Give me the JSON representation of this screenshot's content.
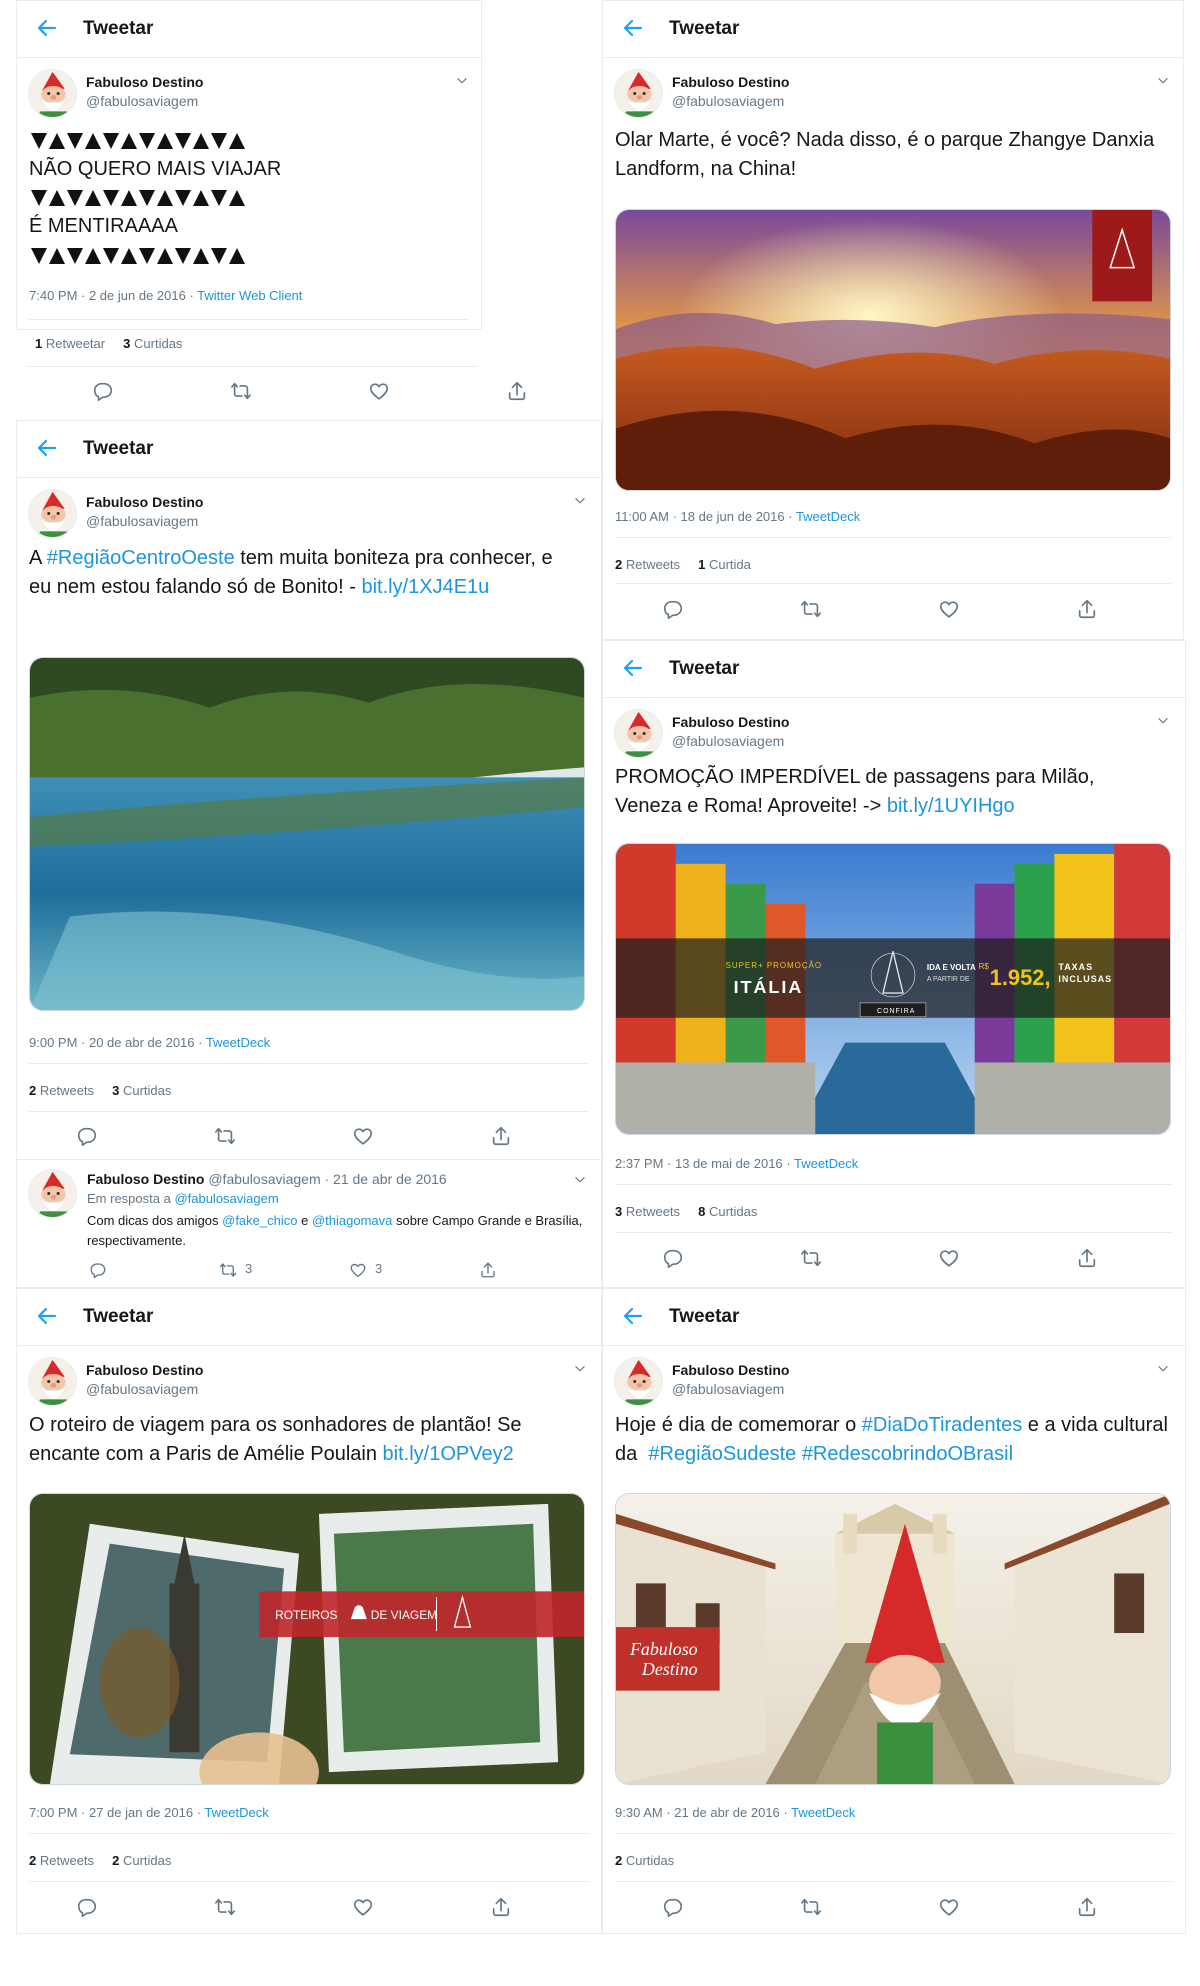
{
  "header_title": "Tweetar",
  "user": {
    "name": "Fabuloso Destino",
    "handle": "@fabulosaviagem"
  },
  "accent": "#1b95e0",
  "tweets": {
    "t1": {
      "line2": "NÃO QUERO MAIS VIAJAR",
      "line4": "É MENTIRAAAA",
      "time": "7:40 PM · 2 de jun de 2016 · ",
      "source": "Twitter Web Client",
      "stat1_num": "1",
      "stat1_label": " Retweetar",
      "stat2_num": "3",
      "stat2_label": " Curtidas"
    },
    "t2": {
      "text": "Olar Marte, é você? Nada disso, é o parque Zhangye Danxia Landform, na China!",
      "time": "11:00 AM · 18 de jun de 2016 · ",
      "source": "TweetDeck",
      "stat1_num": "2",
      "stat1_label": " Retweets",
      "stat2_num": "1",
      "stat2_label": " Curtida"
    },
    "t3": {
      "text_a": "A ",
      "hashtag": "#RegiãoCentroOeste",
      "text_b": " tem muita boniteza pra conhecer, e eu nem estou falando só de Bonito! - ",
      "link": "bit.ly/1XJ4E1u",
      "time": "9:00 PM · 20 de abr de 2016 · ",
      "source": "TweetDeck",
      "stat1_num": "2",
      "stat1_label": " Retweets",
      "stat2_num": "3",
      "stat2_label": " Curtidas"
    },
    "t3_reply": {
      "meta": " @fabulosaviagem · 21 de abr de 2016",
      "in_reply": "Em resposta a ",
      "in_reply_handle": "@fabulosaviagem",
      "text_a": "Com dicas dos amigos ",
      "mention1": "@fake_chico",
      "text_b": " e ",
      "mention2": "@thiagomava",
      "text_c": " sobre Campo Grande e Brasília, respectivamente.",
      "retweets": "3",
      "likes": "3"
    },
    "t4": {
      "text_a": "PROMOÇÃO IMPERDÍVEL de passagens para Milão, Veneza e Roma! Aproveite! -> ",
      "link": "bit.ly/1UYIHgo",
      "banner_small": "SUPER+ PROMOÇÃO",
      "banner_big": "ITÁLIA",
      "banner_cta": "CONFIRA",
      "banner_idavolta": "IDA E VOLTA",
      "banner_apartir": "A PARTIR DE",
      "banner_currency": "R$",
      "banner_price": "1.952,",
      "banner_taxas": "TAXAS",
      "banner_inclusas": "INCLUSAS",
      "time": "2:37 PM · 13 de mai de 2016 · ",
      "source": "TweetDeck",
      "stat1_num": "3",
      "stat1_label": " Retweets",
      "stat2_num": "8",
      "stat2_label": " Curtidas"
    },
    "t5": {
      "text_a": "O roteiro de viagem para os sonhadores de plantão! Se encante com a Paris de Amélie Poulain ",
      "link": "bit.ly/1OPVey2",
      "banner_a": "ROTEIROS",
      "banner_b": "DE VIAGEM",
      "time": "7:00 PM · 27 de jan de 2016 · ",
      "source": "TweetDeck",
      "stat1_num": "2",
      "stat1_label": " Retweets",
      "stat2_num": "2",
      "stat2_label": " Curtidas"
    },
    "t6": {
      "text_a": "Hoje é dia de comemorar o ",
      "hashtag1": "#DiaDoTiradentes",
      "text_b": " e a vida cultural da  ",
      "hashtag2": "#RegiãoSudeste",
      "text_c": " ",
      "hashtag3": "#RedescobrindoOBrasil",
      "logo_a": "Fabuloso",
      "logo_b": "Destino",
      "time": "9:30 AM · 21 de abr de 2016 · ",
      "source": "TweetDeck",
      "stat1_num": "2",
      "stat1_label": " Curtidas"
    }
  },
  "icons": [
    "back-arrow-icon",
    "chevron-down-icon",
    "reply-icon",
    "retweet-icon",
    "like-icon",
    "share-icon",
    "location-pin-icon"
  ]
}
